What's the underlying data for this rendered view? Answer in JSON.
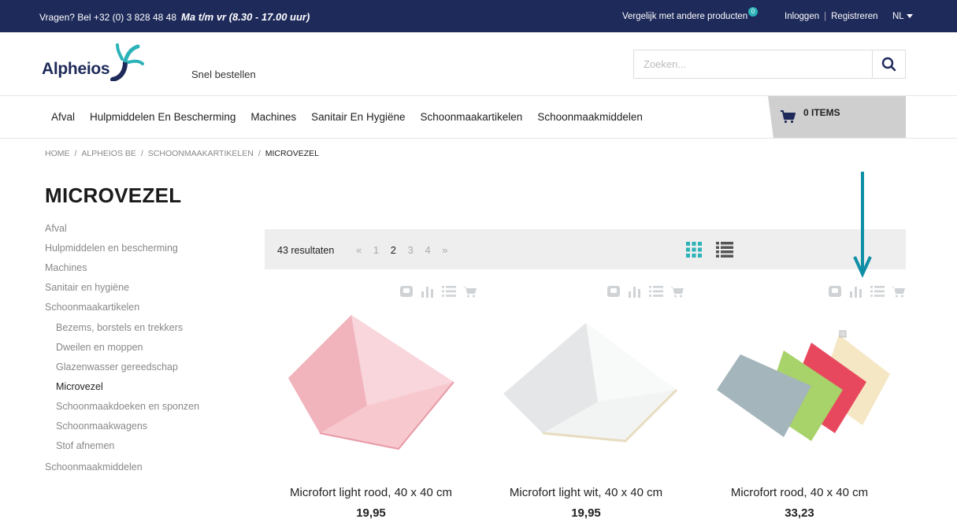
{
  "topbar": {
    "phone_text": "Vragen? Bel +32 (0) 3 828 48 48",
    "hours": "Ma t/m vr (8.30 - 17.00 uur)",
    "compare": "Vergelijk met andere producten",
    "compare_count": "0",
    "login": "Inloggen",
    "separator": "|",
    "register": "Registreren",
    "language": "NL"
  },
  "header": {
    "logo_text": "Alpheios",
    "quick_order": "Snel bestellen",
    "search_placeholder": "Zoeken..."
  },
  "nav": {
    "items": [
      "Afval",
      "Hulpmiddelen En Bescherming",
      "Machines",
      "Sanitair En Hygiëne",
      "Schoonmaakartikelen",
      "Schoonmaakmiddelen"
    ]
  },
  "cart": {
    "label": "0 ITEMS"
  },
  "breadcrumb": {
    "items": [
      "HOME",
      "ALPHEIOS BE",
      "SCHOONMAAKARTIKELEN"
    ],
    "separator": "/",
    "current": "MICROVEZEL"
  },
  "page_title": "MICROVEZEL",
  "sidebar": {
    "items": [
      "Afval",
      "Hulpmiddelen en bescherming",
      "Machines",
      "Sanitair en hygiëne",
      "Schoonmaakartikelen"
    ],
    "subitems": [
      "Bezems, borstels en trekkers",
      "Dweilen en moppen",
      "Glazenwasser gereedschap",
      "Microvezel",
      "Schoonmaakdoeken en sponzen",
      "Schoonmaakwagens",
      "Stof afnemen"
    ],
    "last_item": "Schoonmaakmiddelen"
  },
  "toolbar": {
    "results": "43 resultaten",
    "prev": "«",
    "pages": [
      "1",
      "2",
      "3",
      "4"
    ],
    "current_page": "2",
    "next": "»"
  },
  "products": [
    {
      "name": "Microfort light rood, 40 x 40 cm",
      "price": "19,95"
    },
    {
      "name": "Microfort light wit, 40 x 40 cm",
      "price": "19,95"
    },
    {
      "name": "Microfort rood, 40 x 40 cm",
      "price": "33,23"
    }
  ],
  "colors": {
    "topbar": "#1e2a5a",
    "accent": "#2bb3b8",
    "arrow": "#0e8fa6"
  }
}
